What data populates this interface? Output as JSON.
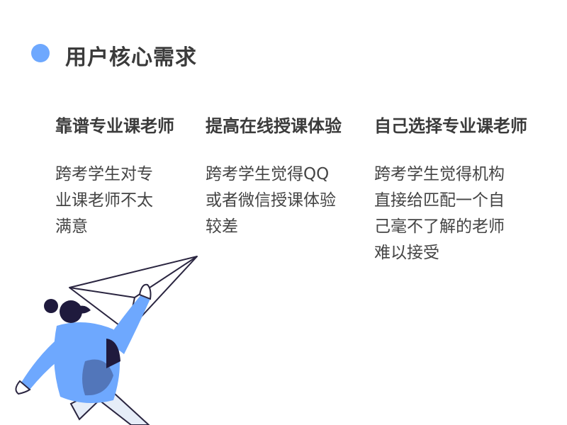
{
  "page": {
    "title": "用户核心需求",
    "accent_color": "#6ea8fe"
  },
  "columns": [
    {
      "heading": "靠谱专业课老师",
      "body": "跨考学生对专\n业课老师不太\n满意"
    },
    {
      "heading": "提高在线授课体验",
      "body": "跨考学生觉得QQ\n或者微信授课体验\n较差"
    },
    {
      "heading": "自己选择专业课老师",
      "body": "跨考学生觉得机构\n直接给匹配一个自\n己毫不了解的老师\n难以接受"
    }
  ],
  "illustration": {
    "icon": "person-throwing-paper-plane-illustration",
    "shirt_color": "#6ea8fe",
    "hair_color": "#1f1a3d"
  }
}
